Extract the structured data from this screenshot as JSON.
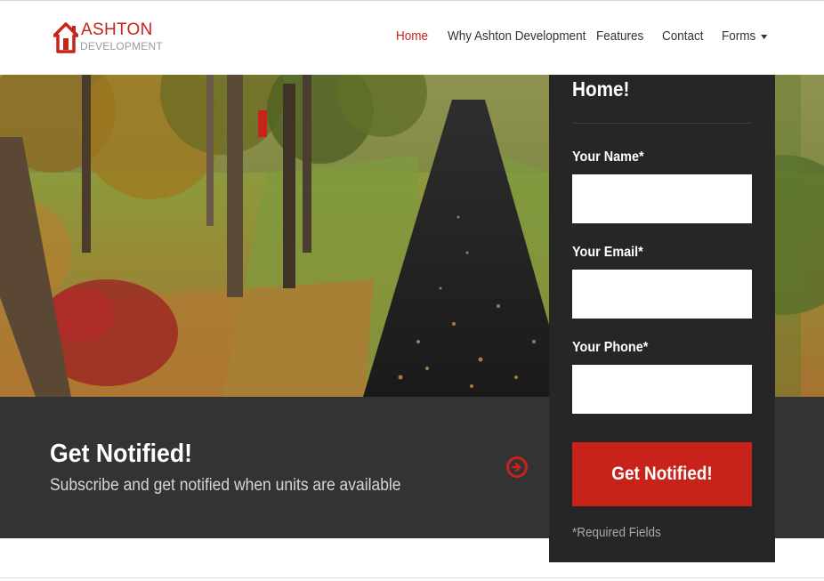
{
  "brand": {
    "name": "ASHTON",
    "tagline": "DEVELOPMENT",
    "color": "#c8231a"
  },
  "nav": {
    "items": [
      {
        "label": "Home",
        "active": true
      },
      {
        "label": "Why Ashton Development",
        "active": false
      },
      {
        "label": "Features",
        "active": false
      },
      {
        "label": "Contact",
        "active": false
      },
      {
        "label": "Forms",
        "active": false,
        "has_dropdown": true
      }
    ]
  },
  "hero": {
    "image": "autumn paved driveway through trees"
  },
  "notify_band": {
    "title": "Get Notified!",
    "subtitle": "Subscribe and get notified when units are available",
    "icon": "circle-arrow-right-icon"
  },
  "form": {
    "title": "Home!",
    "fields": [
      {
        "label": "Your Name*",
        "value": "",
        "placeholder": ""
      },
      {
        "label": "Your Email*",
        "value": "",
        "placeholder": ""
      },
      {
        "label": "Your Phone*",
        "value": "",
        "placeholder": ""
      }
    ],
    "submit_label": "Get Notified!",
    "required_note": "*Required Fields"
  },
  "colors": {
    "accent": "#c8231a",
    "band_bg": "#333333",
    "panel_bg": "#262626"
  }
}
